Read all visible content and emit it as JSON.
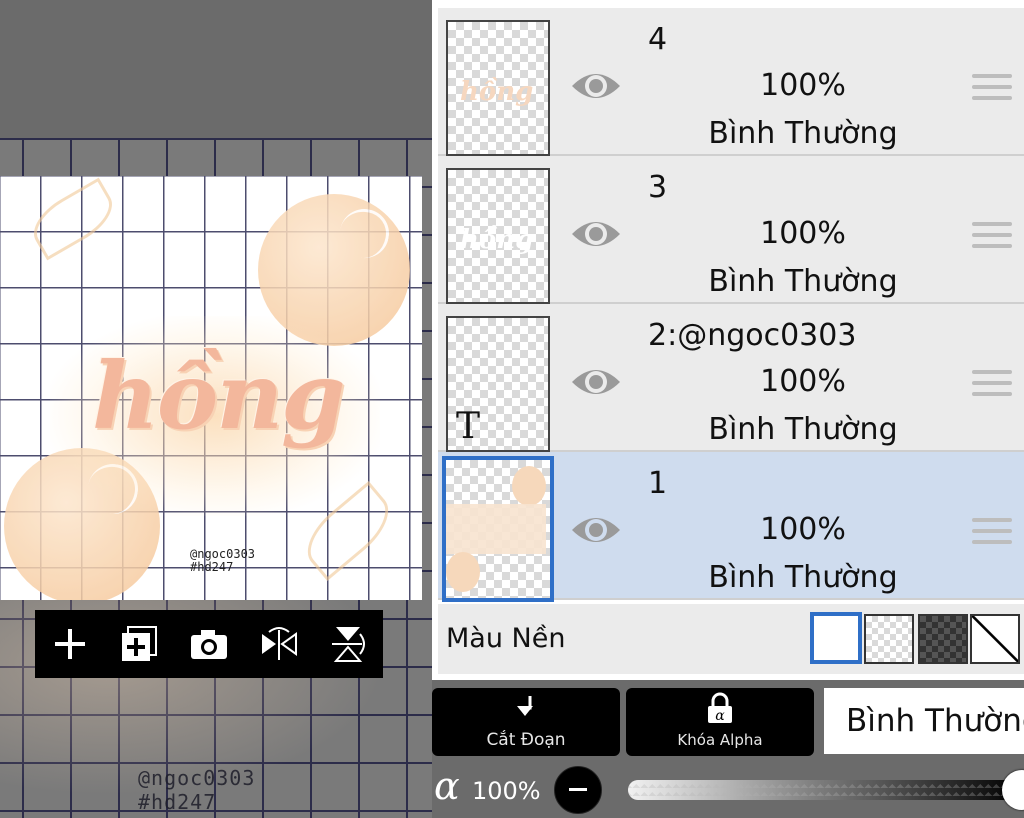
{
  "canvas": {
    "art_word": "hồng",
    "art_signature": [
      "@ngoc0303",
      "#hd247"
    ],
    "ghost_signature": [
      "@ngoc0303",
      "#hd247"
    ],
    "toolbar": [
      {
        "icon": "plus-icon"
      },
      {
        "icon": "add-layer-icon"
      },
      {
        "icon": "camera-icon"
      },
      {
        "icon": "flip-horizontal-icon"
      },
      {
        "icon": "flip-vertical-icon"
      }
    ]
  },
  "layers": [
    {
      "name": "4",
      "opacity": "100%",
      "blend": "Bình Thường",
      "visible": true,
      "selected": false
    },
    {
      "name": "3",
      "opacity": "100%",
      "blend": "Bình Thường",
      "visible": true,
      "selected": false
    },
    {
      "name": "2:@ngoc0303",
      "opacity": "100%",
      "blend": "Bình Thường",
      "visible": true,
      "selected": false,
      "thumb_text": "T"
    },
    {
      "name": "1",
      "opacity": "100%",
      "blend": "Bình Thường",
      "visible": true,
      "selected": true
    }
  ],
  "background": {
    "label": "Màu Nền",
    "options": [
      "white",
      "transparent",
      "dark-checker",
      "none"
    ],
    "selected": "white"
  },
  "controls": {
    "clip_label": "Cắt Đoạn",
    "alpha_lock_label": "Khóa Alpha",
    "blend_mode": "Bình Thường",
    "alpha_symbol": "α",
    "alpha_value": "100%",
    "alpha_fraction": 1.0
  },
  "colors": {
    "selected_row": "#cfdcee",
    "selection_border": "#2f6fc7",
    "peach": "#f3b79c"
  }
}
